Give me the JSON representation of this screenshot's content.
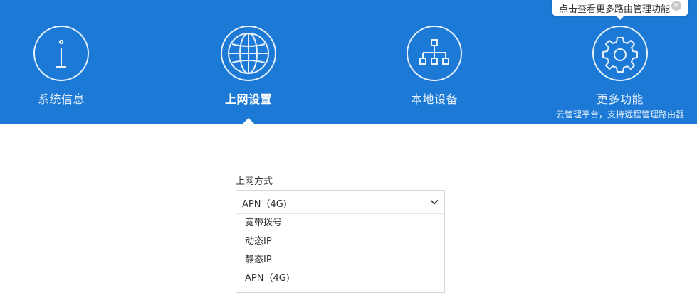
{
  "nav": {
    "items": [
      {
        "label": "系统信息",
        "icon": "info-icon"
      },
      {
        "label": "上网设置",
        "icon": "globe-icon",
        "active": true
      },
      {
        "label": "本地设备",
        "icon": "network-tree-icon"
      },
      {
        "label": "更多功能",
        "icon": "gear-icon",
        "sub": "云管理平台，支持远程管理路由器"
      }
    ]
  },
  "tooltip": {
    "text": "点击查看更多路由管理功能",
    "close_icon": "close-icon"
  },
  "form": {
    "field_label": "上网方式",
    "selected": "APN（4G)",
    "options": [
      "宽带拨号",
      "动态IP",
      "静态IP",
      "APN（4G)"
    ]
  },
  "colors": {
    "header_bg": "#1c7ad6",
    "text": "#333333"
  }
}
